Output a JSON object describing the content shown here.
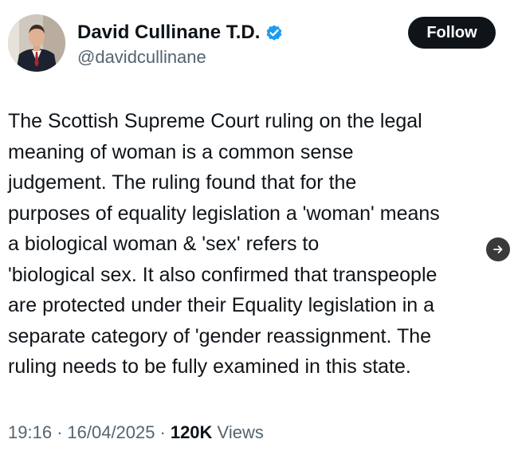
{
  "author": {
    "display_name": "David Cullinane T.D.",
    "handle": "@davidcullinane",
    "verified": true,
    "verified_color": "#1d9bf0"
  },
  "follow_button": {
    "label": "Follow"
  },
  "tweet": {
    "lines": [
      "The Scottish Supreme Court ruling on the legal",
      "meaning of woman is a common sense",
      "judgement. The ruling found that for the",
      "purposes of equality legislation a 'woman' means",
      "a biological woman &  'sex' refers to",
      "'biological sex. It also confirmed that transpeople",
      "are protected under their Equality legislation in a",
      "separate category of 'gender reassignment. The",
      "ruling needs to be fully examined in this state."
    ]
  },
  "meta": {
    "time": "19:16",
    "date": "16/04/2025",
    "separator": "·",
    "views_count": "120K",
    "views_label": "Views"
  },
  "icons": {
    "verified": "verified-badge-icon",
    "arrow": "arrow-right-icon"
  }
}
